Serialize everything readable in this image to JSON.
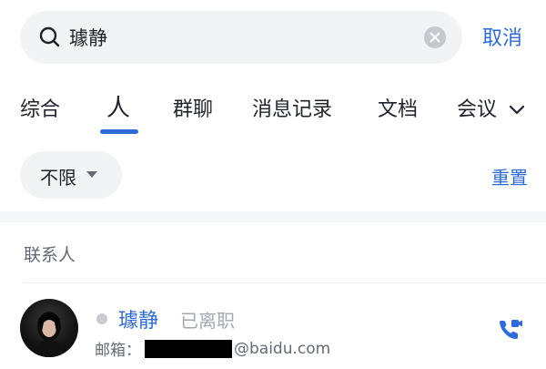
{
  "search": {
    "query": "璩静",
    "cancel_label": "取消"
  },
  "tabs": [
    {
      "label": "综合",
      "active": false
    },
    {
      "label": "人",
      "active": true
    },
    {
      "label": "群聊",
      "active": false
    },
    {
      "label": "消息记录",
      "active": false
    },
    {
      "label": "文档",
      "active": false
    },
    {
      "label": "会议",
      "active": false
    }
  ],
  "filter": {
    "label": "不限",
    "reset_label": "重置"
  },
  "section": {
    "title": "联系人"
  },
  "contact": {
    "name": "璩静",
    "status": "已离职",
    "email_label": "邮箱：",
    "email_domain": "@baidu.com"
  },
  "colors": {
    "accent": "#2f6bd8",
    "chip_bg": "#f2f3f5",
    "muted": "#a3a8b0"
  },
  "icons": [
    "search-icon",
    "clear-icon",
    "chevron-down-icon",
    "caret-down-icon",
    "video-call-icon"
  ]
}
